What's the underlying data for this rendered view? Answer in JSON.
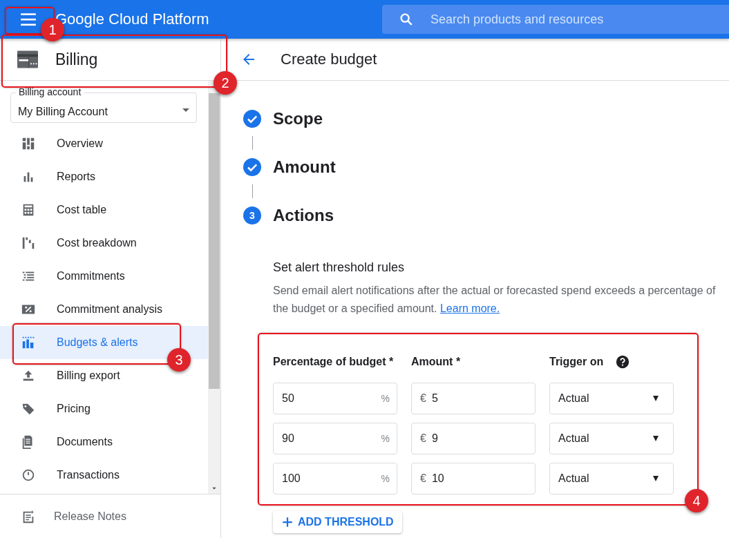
{
  "header": {
    "title": "Google Cloud Platform",
    "search": {
      "placeholder": "Search products and resources"
    }
  },
  "sidebar": {
    "section_title": "Billing",
    "billing_account": {
      "label": "Billing account",
      "value": "My Billing Account"
    },
    "items": [
      {
        "label": "Overview",
        "kind": "overview",
        "selected": false
      },
      {
        "label": "Reports",
        "kind": "reports",
        "selected": false
      },
      {
        "label": "Cost table",
        "kind": "table",
        "selected": false
      },
      {
        "label": "Cost breakdown",
        "kind": "breakdown",
        "selected": false
      },
      {
        "label": "Commitments",
        "kind": "commitments",
        "selected": false
      },
      {
        "label": "Commitment analysis",
        "kind": "percent",
        "selected": false
      },
      {
        "label": "Budgets & alerts",
        "kind": "budgets",
        "selected": true
      },
      {
        "label": "Billing export",
        "kind": "export",
        "selected": false
      },
      {
        "label": "Pricing",
        "kind": "tag",
        "selected": false
      },
      {
        "label": "Documents",
        "kind": "documents",
        "selected": false
      },
      {
        "label": "Transactions",
        "kind": "clock",
        "selected": false
      }
    ],
    "footer_item": {
      "label": "Release Notes"
    }
  },
  "page": {
    "title": "Create budget",
    "steps": [
      {
        "label": "Scope",
        "completed": true
      },
      {
        "label": "Amount",
        "completed": true
      },
      {
        "label": "Actions",
        "completed": false,
        "number": "3"
      }
    ],
    "section": {
      "title": "Set alert threshold rules",
      "description": "Send email alert notifications after the actual or forecasted spend exceeds a percentage of the budget or a specified amount.",
      "link": "Learn more."
    },
    "thresholds": {
      "columns": [
        "Percentage of budget *",
        "Amount *",
        "Trigger on"
      ],
      "rows": [
        {
          "percent": "50",
          "percent_suffix": "%",
          "currency": "€",
          "amount": "5",
          "trigger": "Actual"
        },
        {
          "percent": "90",
          "percent_suffix": "%",
          "currency": "€",
          "amount": "9",
          "trigger": "Actual"
        },
        {
          "percent": "100",
          "percent_suffix": "%",
          "currency": "€",
          "amount": "10",
          "trigger": "Actual"
        }
      ]
    },
    "add_button": "ADD THRESHOLD"
  },
  "annotations": [
    {
      "label": "1"
    },
    {
      "label": "2"
    },
    {
      "label": "3"
    },
    {
      "label": "4"
    }
  ]
}
